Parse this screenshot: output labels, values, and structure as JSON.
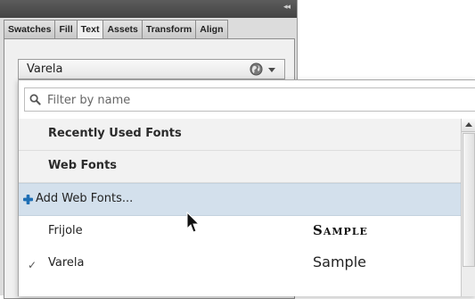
{
  "panel": {
    "tabs": [
      {
        "label": "Swatches",
        "active": false
      },
      {
        "label": "Fill",
        "active": false
      },
      {
        "label": "Text",
        "active": true
      },
      {
        "label": "Assets",
        "active": false
      },
      {
        "label": "Transform",
        "active": false
      },
      {
        "label": "Align",
        "active": false
      }
    ],
    "collapse_icon": "double-chevron-right-icon"
  },
  "font_select": {
    "value": "Varela",
    "icons": [
      "globe-icon",
      "chevron-down-icon"
    ]
  },
  "dropdown": {
    "filter": {
      "placeholder": "Filter by name",
      "value": "",
      "icon": "search-icon"
    },
    "items": [
      {
        "label": "Recently Used Fonts",
        "type": "header"
      },
      {
        "label": "Web Fonts",
        "type": "header"
      },
      {
        "label": "Add Web Fonts...",
        "type": "action",
        "icon": "plus-icon",
        "hovered": true
      },
      {
        "label": "Frijole",
        "type": "font",
        "sample": "Sample",
        "checked": false
      },
      {
        "label": "Varela",
        "type": "font",
        "sample": "Sample",
        "checked": true
      }
    ]
  },
  "colors": {
    "panel_bg": "#dcdcdc",
    "hover_bg": "#d3e0ec",
    "plus_icon": "#1f6fb5"
  }
}
